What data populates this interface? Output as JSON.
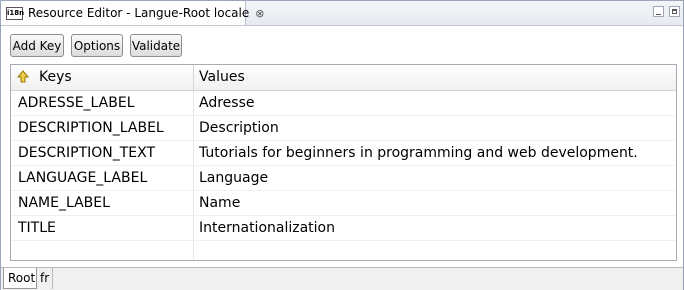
{
  "editor": {
    "tab_title": "Resource Editor - Langue-Root locale",
    "tab_icon_text": "i18n",
    "close_glyph": "⊗"
  },
  "toolbar": {
    "add_key_label": "Add Key",
    "options_label": "Options",
    "validate_label": "Validate"
  },
  "table": {
    "headers": {
      "keys": "Keys",
      "values": "Values"
    },
    "sort_icon": "sort-ascending-icon",
    "rows": [
      {
        "key": "ADRESSE_LABEL",
        "value": "Adresse"
      },
      {
        "key": "DESCRIPTION_LABEL",
        "value": "Description"
      },
      {
        "key": "DESCRIPTION_TEXT",
        "value": "Tutorials for beginners in programming and web development."
      },
      {
        "key": "LANGUAGE_LABEL",
        "value": "Language"
      },
      {
        "key": "NAME_LABEL",
        "value": "Name"
      },
      {
        "key": "TITLE",
        "value": "Internationalization"
      }
    ]
  },
  "locale_tabs": {
    "root": "Root",
    "fr": "fr"
  },
  "colors": {
    "sort_icon": "#d6a800",
    "border": "#9aa6b8"
  }
}
